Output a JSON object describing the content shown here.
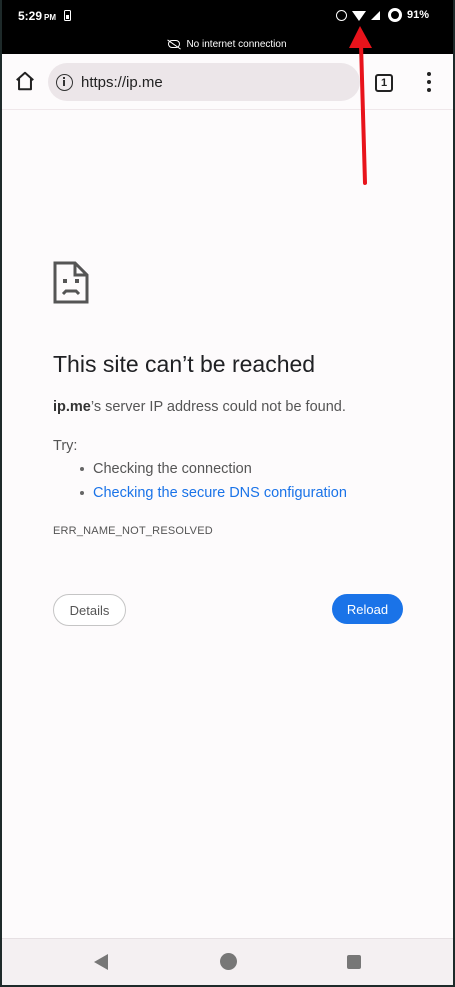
{
  "status_bar": {
    "time": "5:29",
    "ampm": "PM",
    "battery_percent": "91%",
    "icons": [
      "battery-saver-icon",
      "alarm-icon",
      "wifi-icon",
      "cell-signal-icon",
      "battery-ring-icon"
    ]
  },
  "offline_banner": {
    "text": "No internet connection",
    "icon": "cloud-off-icon"
  },
  "toolbar": {
    "url": "https://ip.me",
    "tab_count": "1",
    "icons": [
      "home-icon",
      "info-icon",
      "tab-switcher-icon",
      "overflow-menu-icon"
    ]
  },
  "error_page": {
    "icon": "sad-page-icon",
    "title": "This site can’t be reached",
    "host": "ip.me",
    "description_rest": "’s server IP address could not be found.",
    "try_label": "Try:",
    "suggestions": [
      {
        "text": "Checking the connection",
        "is_link": false
      },
      {
        "text": "Checking the secure DNS configuration",
        "is_link": true
      }
    ],
    "error_code": "ERR_NAME_NOT_RESOLVED",
    "details_label": "Details",
    "reload_label": "Reload"
  },
  "colors": {
    "accent": "#1a73e8",
    "annotation_arrow": "#e8131b"
  },
  "nav_bar": {
    "icons": [
      "back-icon",
      "home-circle-icon",
      "recents-icon"
    ]
  }
}
